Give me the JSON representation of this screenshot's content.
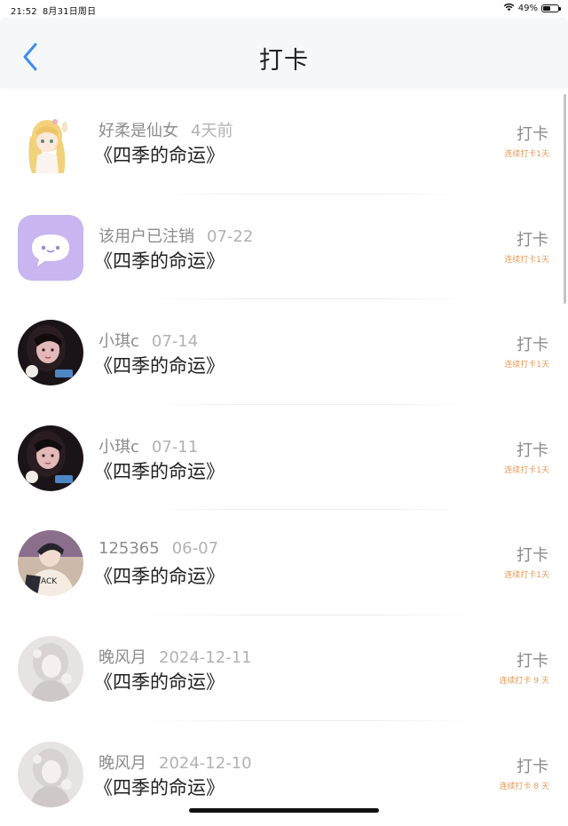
{
  "status_bar": {
    "time": "21:52",
    "date": "8月31日周日",
    "battery": "49%",
    "battery_level": 0.49,
    "icons": [
      "wifi-icon",
      "battery-icon"
    ]
  },
  "header": {
    "title": "打卡",
    "back_icon": "chevron-left-icon",
    "accent": "#3d8ef0"
  },
  "list": {
    "items": [
      {
        "username": "好柔是仙女",
        "time": "4天前",
        "book": "《四季的命运》",
        "action": "打卡",
        "streak": "连续打卡1天",
        "avatar": "anime-girl-blonde"
      },
      {
        "username": "该用户已注销",
        "time": "07-22",
        "book": "《四季的命运》",
        "action": "打卡",
        "streak": "连续打卡1天",
        "avatar": "default-chat-bubble"
      },
      {
        "username": "小琪c",
        "time": "07-14",
        "book": "《四季的命运》",
        "action": "打卡",
        "streak": "连续打卡1天",
        "avatar": "dark-photo-girl"
      },
      {
        "username": "小琪c",
        "time": "07-11",
        "book": "《四季的命运》",
        "action": "打卡",
        "streak": "连续打卡1天",
        "avatar": "dark-photo-girl"
      },
      {
        "username": "125365",
        "time": "06-07",
        "book": "《四季的命运》",
        "action": "打卡",
        "streak": "连续打卡1天",
        "avatar": "anime-boy-jacket"
      },
      {
        "username": "晚风月",
        "time": "2024-12-11",
        "book": "《四季的命运》",
        "action": "打卡",
        "streak": "连续打卡 9 天",
        "avatar": "pale-anime-girl"
      },
      {
        "username": "晚风月",
        "time": "2024-12-10",
        "book": "《四季的命运》",
        "action": "打卡",
        "streak": "连续打卡 8 天",
        "avatar": "pale-anime-girl"
      }
    ]
  },
  "colors": {
    "streak": "#e79a56",
    "meta": "#8c8c8c",
    "title": "#1f1f1f"
  }
}
